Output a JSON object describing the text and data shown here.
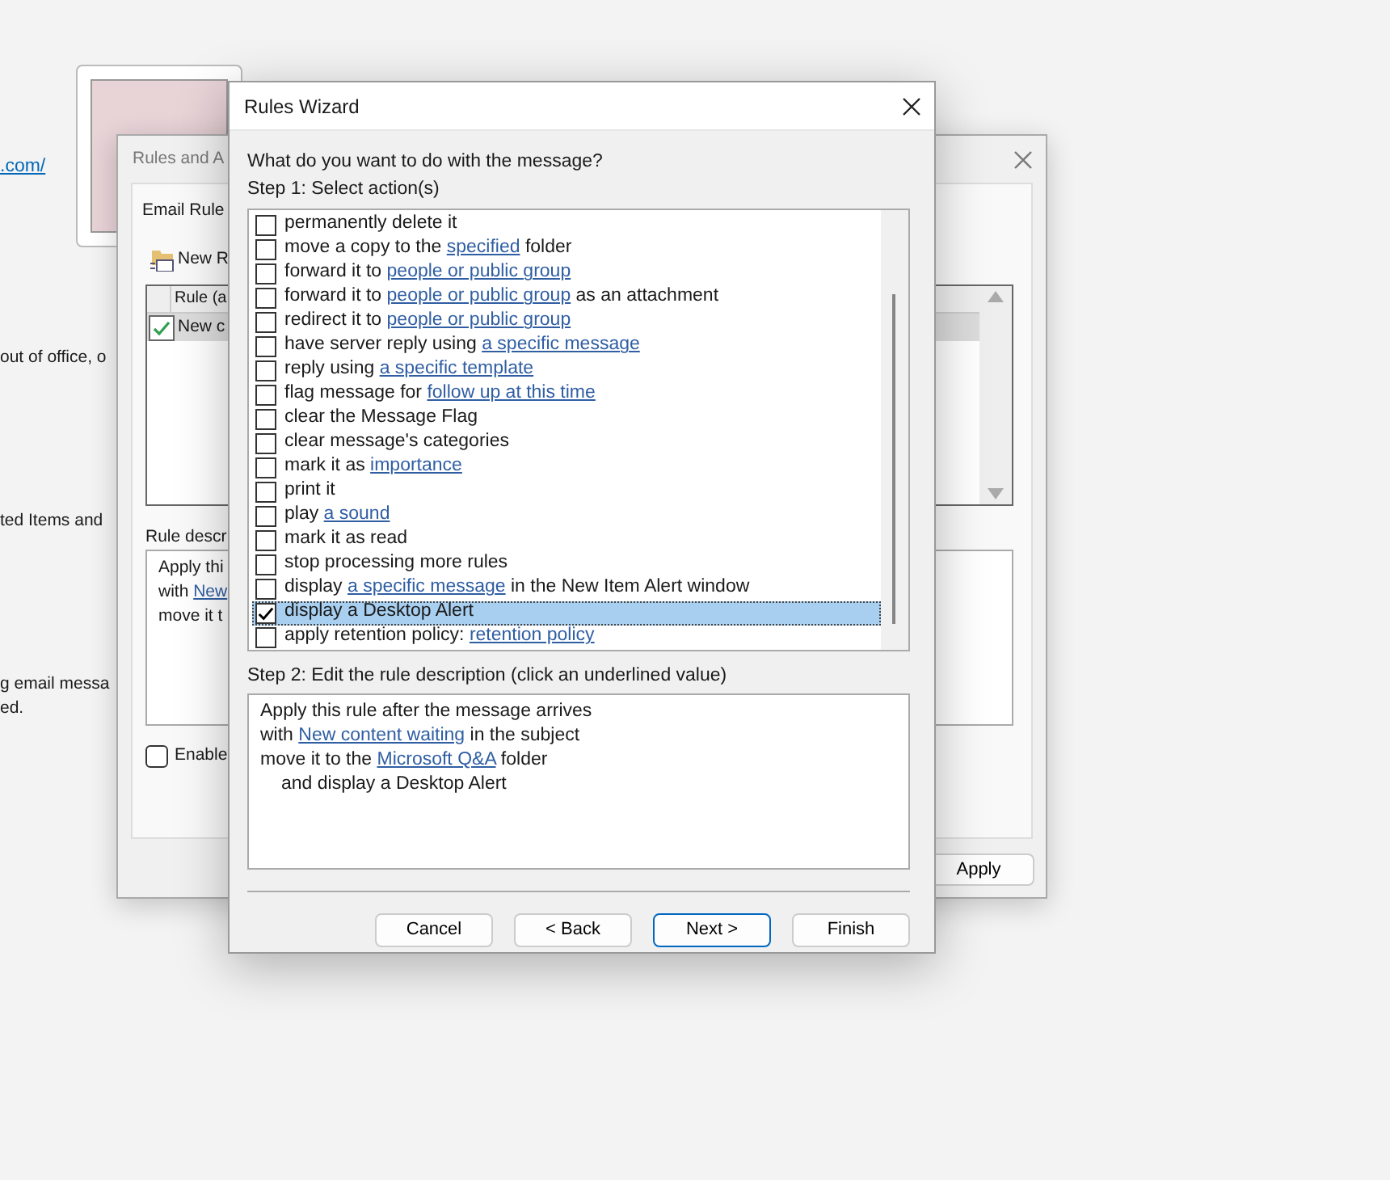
{
  "background_page": {
    "link": ".com/",
    "lines": [
      "out of office, o",
      "ted Items and",
      "g email messa",
      "ed."
    ]
  },
  "back_window": {
    "title": "Rules and A",
    "tab": "Email Rule",
    "new_rule": "New R",
    "table": {
      "columns": [
        "Rule (a"
      ],
      "rows": [
        {
          "checked": true,
          "selected": true,
          "cells": [
            "New c"
          ]
        }
      ]
    },
    "description_label": "Rule descr",
    "description": [
      [
        {
          "text": "Apply thi",
          "kind": "text"
        }
      ],
      [
        {
          "text": "with ",
          "kind": "text"
        },
        {
          "text": "New",
          "kind": "link"
        }
      ],
      [
        {
          "text": "move it t",
          "kind": "text"
        }
      ]
    ],
    "enable": {
      "label": "Enable",
      "checked": false
    },
    "apply_button": "Apply"
  },
  "dialog": {
    "title": "Rules Wizard",
    "question": "What do you want to do with the message?",
    "step1": "Step 1: Select action(s)",
    "actions": [
      {
        "checked": false,
        "selected": false,
        "parts": [
          {
            "text": "permanently delete it",
            "kind": "text"
          }
        ]
      },
      {
        "checked": false,
        "selected": false,
        "parts": [
          {
            "text": "move a copy to the ",
            "kind": "text"
          },
          {
            "text": "specified",
            "kind": "link"
          },
          {
            "text": " folder",
            "kind": "text"
          }
        ]
      },
      {
        "checked": false,
        "selected": false,
        "parts": [
          {
            "text": "forward it to ",
            "kind": "text"
          },
          {
            "text": "people or public group",
            "kind": "link"
          }
        ]
      },
      {
        "checked": false,
        "selected": false,
        "parts": [
          {
            "text": "forward it to ",
            "kind": "text"
          },
          {
            "text": "people or public group",
            "kind": "link"
          },
          {
            "text": " as an attachment",
            "kind": "text"
          }
        ]
      },
      {
        "checked": false,
        "selected": false,
        "parts": [
          {
            "text": "redirect it to ",
            "kind": "text"
          },
          {
            "text": "people or public group",
            "kind": "link"
          }
        ]
      },
      {
        "checked": false,
        "selected": false,
        "parts": [
          {
            "text": "have server reply using ",
            "kind": "text"
          },
          {
            "text": "a specific message",
            "kind": "link"
          }
        ]
      },
      {
        "checked": false,
        "selected": false,
        "parts": [
          {
            "text": "reply using ",
            "kind": "text"
          },
          {
            "text": "a specific template",
            "kind": "link"
          }
        ]
      },
      {
        "checked": false,
        "selected": false,
        "parts": [
          {
            "text": "flag message for ",
            "kind": "text"
          },
          {
            "text": "follow up at this time",
            "kind": "link"
          }
        ]
      },
      {
        "checked": false,
        "selected": false,
        "parts": [
          {
            "text": "clear the Message Flag",
            "kind": "text"
          }
        ]
      },
      {
        "checked": false,
        "selected": false,
        "parts": [
          {
            "text": "clear message's categories",
            "kind": "text"
          }
        ]
      },
      {
        "checked": false,
        "selected": false,
        "parts": [
          {
            "text": "mark it as ",
            "kind": "text"
          },
          {
            "text": "importance",
            "kind": "link"
          }
        ]
      },
      {
        "checked": false,
        "selected": false,
        "parts": [
          {
            "text": "print it",
            "kind": "text"
          }
        ]
      },
      {
        "checked": false,
        "selected": false,
        "parts": [
          {
            "text": "play ",
            "kind": "text"
          },
          {
            "text": "a sound",
            "kind": "link"
          }
        ]
      },
      {
        "checked": false,
        "selected": false,
        "parts": [
          {
            "text": "mark it as read",
            "kind": "text"
          }
        ]
      },
      {
        "checked": false,
        "selected": false,
        "parts": [
          {
            "text": "stop processing more rules",
            "kind": "text"
          }
        ]
      },
      {
        "checked": false,
        "selected": false,
        "parts": [
          {
            "text": "display ",
            "kind": "text"
          },
          {
            "text": "a specific message",
            "kind": "link"
          },
          {
            "text": " in the New Item Alert window",
            "kind": "text"
          }
        ]
      },
      {
        "checked": true,
        "selected": true,
        "parts": [
          {
            "text": "display a Desktop Alert",
            "kind": "text"
          }
        ]
      },
      {
        "checked": false,
        "selected": false,
        "parts": [
          {
            "text": "apply retention policy: ",
            "kind": "text"
          },
          {
            "text": "retention policy",
            "kind": "link"
          }
        ]
      }
    ],
    "step2": "Step 2: Edit the rule description (click an underlined value)",
    "description": [
      {
        "indent": false,
        "parts": [
          {
            "text": "Apply this rule after the message arrives",
            "kind": "text"
          }
        ]
      },
      {
        "indent": false,
        "parts": [
          {
            "text": "with ",
            "kind": "text"
          },
          {
            "text": "New content waiting",
            "kind": "link"
          },
          {
            "text": " in the subject",
            "kind": "text"
          }
        ]
      },
      {
        "indent": false,
        "parts": [
          {
            "text": "move it to the ",
            "kind": "text"
          },
          {
            "text": "Microsoft Q&A",
            "kind": "link"
          },
          {
            "text": " folder",
            "kind": "text"
          }
        ]
      },
      {
        "indent": true,
        "parts": [
          {
            "text": "and display a Desktop Alert",
            "kind": "text"
          }
        ]
      }
    ],
    "buttons": [
      {
        "label": "Cancel",
        "default": false
      },
      {
        "label": "< Back",
        "default": false
      },
      {
        "label": "Next >",
        "default": true
      },
      {
        "label": "Finish",
        "default": false
      }
    ]
  }
}
